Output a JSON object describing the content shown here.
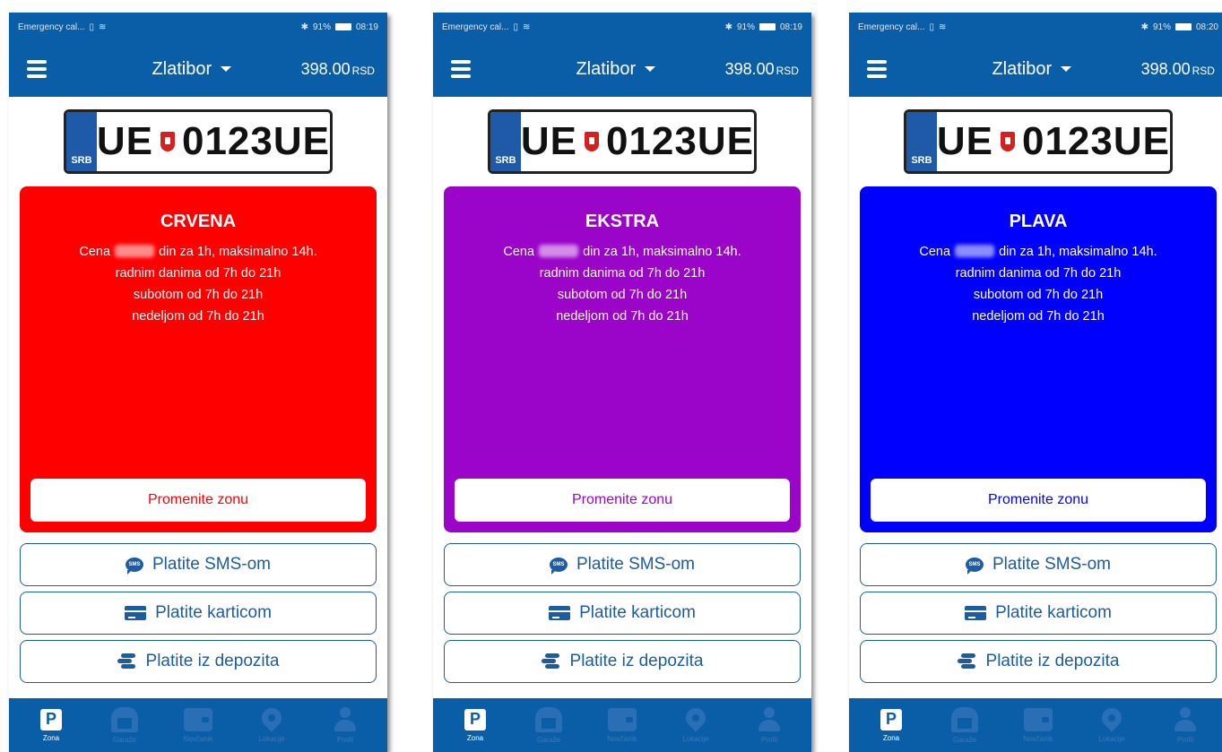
{
  "status_bar": {
    "carrier": "Emergency cal...",
    "percent": "91%",
    "times": [
      "08:19",
      "08:19",
      "08:20"
    ]
  },
  "app_bar": {
    "city": "Zlatibor",
    "balance": "398.00",
    "currency": "RSD"
  },
  "plate": {
    "country": "SRB",
    "left": "UE",
    "right": "0123UE"
  },
  "screens": [
    {
      "zone_name": "CRVENA",
      "color": "#ff0000",
      "desc_prefix": "Cena",
      "desc_line1_rest": "din za 1h, maksimalno 14h.",
      "desc_line2": "radnim danima od 7h do 21h",
      "desc_line3": "subotom od 7h do 21h",
      "desc_line4": "nedeljom od 7h do 21h",
      "change_label": "Promenite zonu"
    },
    {
      "zone_name": "EKSTRA",
      "color": "#9b04c9",
      "desc_prefix": "Cena",
      "desc_line1_rest": "din za 1h, maksimalno 14h.",
      "desc_line2": "radnim danima od 7h do 21h",
      "desc_line3": "subotom od 7h do 21h",
      "desc_line4": "nedeljom od 7h do 21h",
      "change_label": "Promenite zonu"
    },
    {
      "zone_name": "PLAVA",
      "color": "#0000ff",
      "desc_prefix": "Cena",
      "desc_line1_rest": "din za 1h, maksimalno 14h.",
      "desc_line2": "radnim danima od 7h do 21h",
      "desc_line3": "subotom od 7h do 21h",
      "desc_line4": "nedeljom od 7h do 21h",
      "change_label": "Promenite zonu"
    }
  ],
  "payments": {
    "sms": "Platite SMS-om",
    "card": "Platite karticom",
    "deposit": "Platite iz depozita",
    "sms_icon_text": "SMS"
  },
  "bottom_nav": {
    "zona": "Zona",
    "garage": "Garaže",
    "wallet": "Novčanik",
    "location": "Lokacije",
    "profile": "Profil"
  },
  "icons": [
    "menu-icon",
    "caret-down-icon",
    "serbia-shield-icon",
    "sms-icon",
    "card-icon",
    "coins-icon",
    "parking-icon",
    "garage-icon",
    "wallet-icon",
    "location-pin-icon",
    "profile-icon"
  ]
}
